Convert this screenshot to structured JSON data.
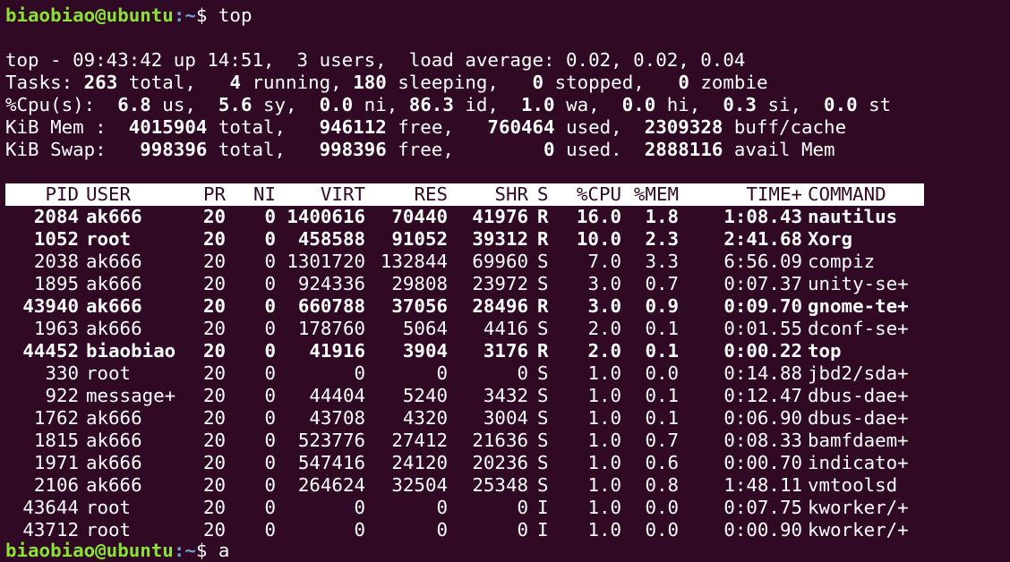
{
  "prompt": {
    "user_host": "biaobiao@ubuntu",
    "path": ":~",
    "symbol": "$ ",
    "command": "top"
  },
  "summary": {
    "line1": "top - 09:43:42 up 14:51,  3 users,  load average: 0.02, 0.02, 0.04",
    "tasks": {
      "label": "Tasks: ",
      "total": "263",
      "total_label": " total,   ",
      "running": "4",
      "running_label": " running, ",
      "sleeping": "180",
      "sleeping_label": " sleeping,   ",
      "stopped": "0",
      "stopped_label": " stopped,   ",
      "zombie": "0",
      "zombie_label": " zombie"
    },
    "cpu": {
      "label": "%Cpu(s):  ",
      "us": "6.8",
      "us_label": " us,  ",
      "sy": "5.6",
      "sy_label": " sy,  ",
      "ni": "0.0",
      "ni_label": " ni, ",
      "id": "86.3",
      "id_label": " id,  ",
      "wa": "1.0",
      "wa_label": " wa,  ",
      "hi": "0.0",
      "hi_label": " hi,  ",
      "si": "0.3",
      "si_label": " si,  ",
      "st": "0.0",
      "st_label": " st"
    },
    "mem": {
      "label": "KiB Mem :  ",
      "total": "4015904",
      "total_label": " total,   ",
      "free": "946112",
      "free_label": " free,   ",
      "used": "760464",
      "used_label": " used,  ",
      "buff": "2309328",
      "buff_label": " buff/cache"
    },
    "swap": {
      "label": "KiB Swap:   ",
      "total": "998396",
      "total_label": " total,   ",
      "free": "998396",
      "free_label": " free,        ",
      "used": "0",
      "used_label": " used.  ",
      "avail": "2888116",
      "avail_label": " avail Mem"
    }
  },
  "table": {
    "columns": [
      "PID",
      "USER",
      "PR",
      "NI",
      "VIRT",
      "RES",
      "SHR",
      "S",
      "%CPU",
      "%MEM",
      "TIME+",
      "COMMAND"
    ],
    "rows": [
      {
        "pid": "2084",
        "user": "ak666",
        "pr": "20",
        "ni": "0",
        "virt": "1400616",
        "res": "70440",
        "shr": "41976",
        "s": "R",
        "cpu": "16.0",
        "mem": "1.8",
        "time": "1:08.43",
        "cmd": "nautilus",
        "bold": true
      },
      {
        "pid": "1052",
        "user": "root",
        "pr": "20",
        "ni": "0",
        "virt": "458588",
        "res": "91052",
        "shr": "39312",
        "s": "R",
        "cpu": "10.0",
        "mem": "2.3",
        "time": "2:41.68",
        "cmd": "Xorg",
        "bold": true
      },
      {
        "pid": "2038",
        "user": "ak666",
        "pr": "20",
        "ni": "0",
        "virt": "1301720",
        "res": "132844",
        "shr": "69960",
        "s": "S",
        "cpu": "7.0",
        "mem": "3.3",
        "time": "6:56.09",
        "cmd": "compiz",
        "bold": false
      },
      {
        "pid": "1895",
        "user": "ak666",
        "pr": "20",
        "ni": "0",
        "virt": "924336",
        "res": "29808",
        "shr": "23972",
        "s": "S",
        "cpu": "3.0",
        "mem": "0.7",
        "time": "0:07.37",
        "cmd": "unity-se+",
        "bold": false
      },
      {
        "pid": "43940",
        "user": "ak666",
        "pr": "20",
        "ni": "0",
        "virt": "660788",
        "res": "37056",
        "shr": "28496",
        "s": "R",
        "cpu": "3.0",
        "mem": "0.9",
        "time": "0:09.70",
        "cmd": "gnome-te+",
        "bold": true
      },
      {
        "pid": "1963",
        "user": "ak666",
        "pr": "20",
        "ni": "0",
        "virt": "178760",
        "res": "5064",
        "shr": "4416",
        "s": "S",
        "cpu": "2.0",
        "mem": "0.1",
        "time": "0:01.55",
        "cmd": "dconf-se+",
        "bold": false
      },
      {
        "pid": "44452",
        "user": "biaobiao",
        "pr": "20",
        "ni": "0",
        "virt": "41916",
        "res": "3904",
        "shr": "3176",
        "s": "R",
        "cpu": "2.0",
        "mem": "0.1",
        "time": "0:00.22",
        "cmd": "top",
        "bold": true
      },
      {
        "pid": "330",
        "user": "root",
        "pr": "20",
        "ni": "0",
        "virt": "0",
        "res": "0",
        "shr": "0",
        "s": "S",
        "cpu": "1.0",
        "mem": "0.0",
        "time": "0:14.88",
        "cmd": "jbd2/sda+",
        "bold": false
      },
      {
        "pid": "922",
        "user": "message+",
        "pr": "20",
        "ni": "0",
        "virt": "44404",
        "res": "5240",
        "shr": "3432",
        "s": "S",
        "cpu": "1.0",
        "mem": "0.1",
        "time": "0:12.47",
        "cmd": "dbus-dae+",
        "bold": false
      },
      {
        "pid": "1762",
        "user": "ak666",
        "pr": "20",
        "ni": "0",
        "virt": "43708",
        "res": "4320",
        "shr": "3004",
        "s": "S",
        "cpu": "1.0",
        "mem": "0.1",
        "time": "0:06.90",
        "cmd": "dbus-dae+",
        "bold": false
      },
      {
        "pid": "1815",
        "user": "ak666",
        "pr": "20",
        "ni": "0",
        "virt": "523776",
        "res": "27412",
        "shr": "21636",
        "s": "S",
        "cpu": "1.0",
        "mem": "0.7",
        "time": "0:08.33",
        "cmd": "bamfdaem+",
        "bold": false
      },
      {
        "pid": "1971",
        "user": "ak666",
        "pr": "20",
        "ni": "0",
        "virt": "547416",
        "res": "24120",
        "shr": "20236",
        "s": "S",
        "cpu": "1.0",
        "mem": "0.6",
        "time": "0:00.70",
        "cmd": "indicato+",
        "bold": false
      },
      {
        "pid": "2106",
        "user": "ak666",
        "pr": "20",
        "ni": "0",
        "virt": "264624",
        "res": "32504",
        "shr": "25348",
        "s": "S",
        "cpu": "1.0",
        "mem": "0.8",
        "time": "1:48.11",
        "cmd": "vmtoolsd",
        "bold": false
      },
      {
        "pid": "43644",
        "user": "root",
        "pr": "20",
        "ni": "0",
        "virt": "0",
        "res": "0",
        "shr": "0",
        "s": "I",
        "cpu": "1.0",
        "mem": "0.0",
        "time": "0:07.75",
        "cmd": "kworker/+",
        "bold": false
      },
      {
        "pid": "43712",
        "user": "root",
        "pr": "20",
        "ni": "0",
        "virt": "0",
        "res": "0",
        "shr": "0",
        "s": "I",
        "cpu": "1.0",
        "mem": "0.0",
        "time": "0:00.90",
        "cmd": "kworker/+",
        "bold": false
      }
    ]
  },
  "bottom_prompt": {
    "user_host": "biaobiao@ubuntu",
    "path": ":~",
    "symbol": "$ a"
  },
  "colors": {
    "background": "#300a24",
    "text": "#ffffff",
    "prompt_user": "#8ae234",
    "prompt_path": "#729fcf"
  }
}
